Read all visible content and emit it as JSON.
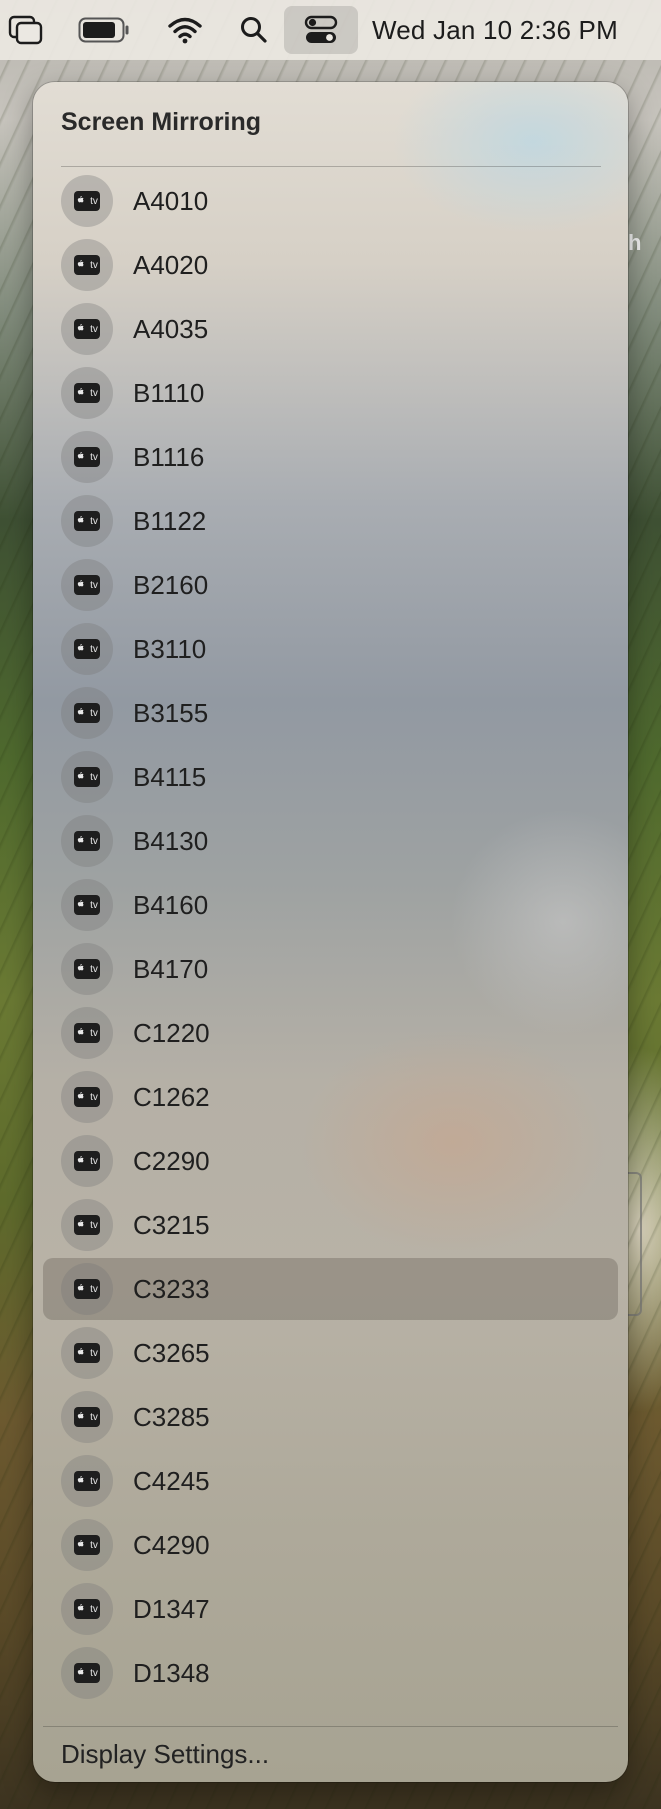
{
  "menubar": {
    "clock": "Wed Jan 10  2:36 PM",
    "icons": [
      "window-stack-icon",
      "battery-icon",
      "wifi-icon",
      "search-icon",
      "control-center-icon"
    ]
  },
  "wallpaper": {
    "partial_text": "h"
  },
  "panel": {
    "title": "Screen Mirroring",
    "device_icon": "apple-tv-icon",
    "device_icon_text": "tv",
    "devices": [
      "A4010",
      "A4020",
      "A4035",
      "B1110",
      "B1116",
      "B1122",
      "B2160",
      "B3110",
      "B3155",
      "B4115",
      "B4130",
      "B4160",
      "B4170",
      "C1220",
      "C1262",
      "C2290",
      "C3215",
      "C3233",
      "C3265",
      "C3285",
      "C4245",
      "C4290",
      "D1347",
      "D1348"
    ],
    "selected_device": "C3233",
    "footer_link": "Display Settings..."
  }
}
